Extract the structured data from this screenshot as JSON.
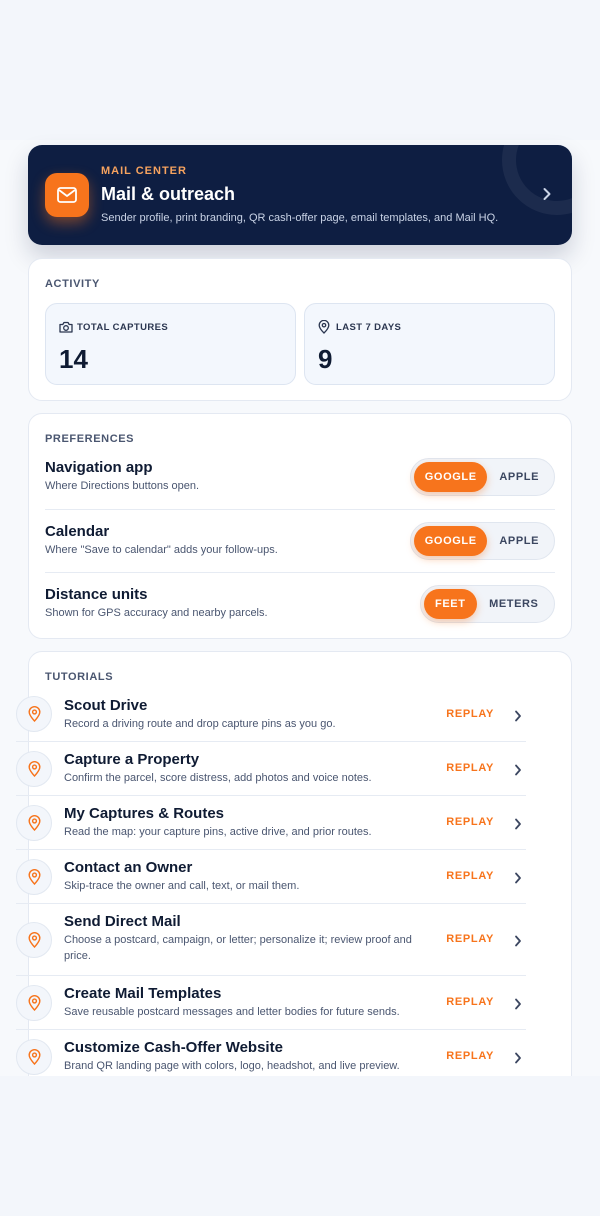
{
  "mail_center": {
    "eyebrow": "MAIL CENTER",
    "title": "Mail & outreach",
    "subtitle": "Sender profile, print branding, QR cash-offer page, email templates, and Mail HQ."
  },
  "activity": {
    "title": "ACTIVITY",
    "stats": [
      {
        "label": "TOTAL CAPTURES",
        "value": "14",
        "icon": "camera-icon"
      },
      {
        "label": "LAST 7 DAYS",
        "value": "9",
        "icon": "map-pin-icon"
      }
    ]
  },
  "preferences": {
    "title": "PREFERENCES",
    "items": [
      {
        "title": "Navigation app",
        "subtitle": "Where Directions buttons open.",
        "options": [
          "GOOGLE",
          "APPLE"
        ],
        "selected": "GOOGLE"
      },
      {
        "title": "Calendar",
        "subtitle": "Where \"Save to calendar\" adds your follow-ups.",
        "options": [
          "GOOGLE",
          "APPLE"
        ],
        "selected": "GOOGLE"
      },
      {
        "title": "Distance units",
        "subtitle": "Shown for GPS accuracy and nearby parcels.",
        "options": [
          "FEET",
          "METERS"
        ],
        "selected": "FEET"
      }
    ]
  },
  "tutorials": {
    "title": "TUTORIALS",
    "replay_label": "REPLAY",
    "items": [
      {
        "title": "Scout Drive",
        "description": "Record a driving route and drop capture pins as you go."
      },
      {
        "title": "Capture a Property",
        "description": "Confirm the parcel, score distress, add photos and voice notes."
      },
      {
        "title": "My Captures & Routes",
        "description": "Read the map: your capture pins, active drive, and prior routes."
      },
      {
        "title": "Contact an Owner",
        "description": "Skip-trace the owner and call, text, or mail them."
      },
      {
        "title": "Send Direct Mail",
        "description": "Choose a postcard, campaign, or letter; personalize it; review proof and price."
      },
      {
        "title": "Create Mail Templates",
        "description": "Save reusable postcard messages and letter bodies for future sends."
      },
      {
        "title": "Customize Cash-Offer Website",
        "description": "Brand QR landing page with colors, logo, headshot, and live preview."
      }
    ]
  },
  "colors": {
    "accent": "#f7741c",
    "navy": "#0e1e42",
    "background": "#f3f6fb"
  }
}
